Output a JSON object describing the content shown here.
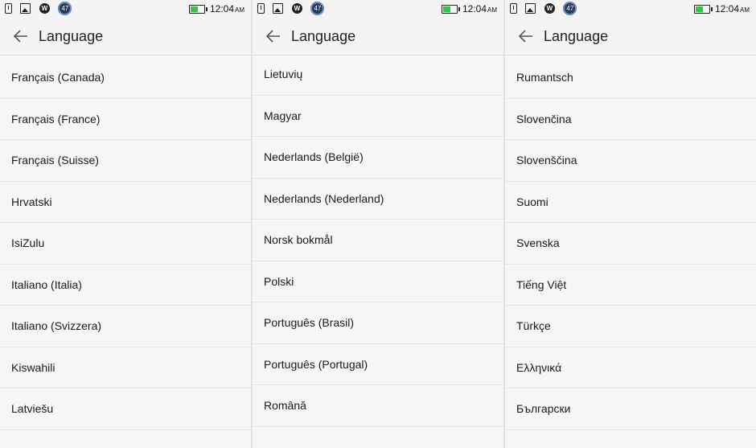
{
  "colors": {
    "battery_fill": "#3cc34a",
    "background": "#f6f6f6"
  },
  "panels": [
    {
      "status": {
        "time": "12:04",
        "ampm": "AM",
        "badge": "47",
        "w_icon": "W",
        "battery_level": 0.55
      },
      "header": {
        "title": "Language",
        "back_icon": "arrow-left-icon"
      },
      "items": [
        "Français (Canada)",
        "Français (France)",
        "Français (Suisse)",
        "Hrvatski",
        "IsiZulu",
        "Italiano (Italia)",
        "Italiano (Svizzera)",
        "Kiswahili",
        "Latviešu"
      ]
    },
    {
      "status": {
        "time": "12:04",
        "ampm": "AM",
        "badge": "47",
        "w_icon": "W",
        "battery_level": 0.55
      },
      "header": {
        "title": "Language",
        "back_icon": "arrow-left-icon"
      },
      "items": [
        "Lietuvių",
        "Magyar",
        "Nederlands (België)",
        "Nederlands (Nederland)",
        "Norsk bokmål",
        "Polski",
        "Português (Brasil)",
        "Português (Portugal)",
        "Română"
      ]
    },
    {
      "status": {
        "time": "12:04",
        "ampm": "AM",
        "badge": "47",
        "w_icon": "W",
        "battery_level": 0.55
      },
      "header": {
        "title": "Language",
        "back_icon": "arrow-left-icon"
      },
      "items": [
        "Rumantsch",
        "Slovenčina",
        "Slovenščina",
        "Suomi",
        "Svenska",
        "Tiếng Việt",
        "Türkçe",
        "Ελληνικά",
        "Български"
      ]
    }
  ]
}
